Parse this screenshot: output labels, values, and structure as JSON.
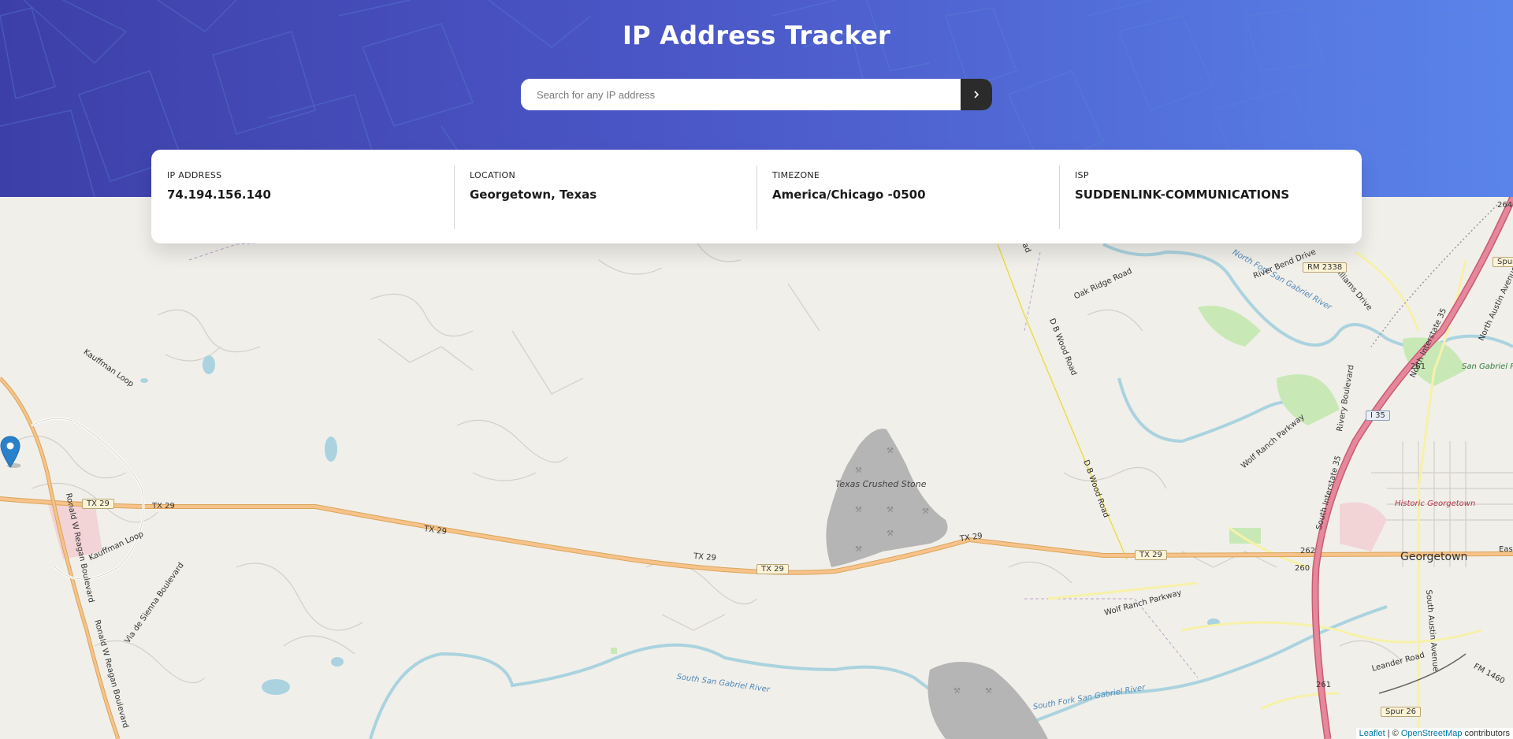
{
  "header": {
    "title": "IP Address Tracker",
    "search": {
      "placeholder": "Search for any IP address",
      "value": "",
      "submit_icon": "chevron-right-icon"
    }
  },
  "info": [
    {
      "label": "IP Address",
      "value": "74.194.156.140"
    },
    {
      "label": "Location",
      "value": "Georgetown, Texas"
    },
    {
      "label": "Timezone",
      "value": "America/Chicago -0500"
    },
    {
      "label": "ISP",
      "value": "SUDDENLINK-COMMUNICATIONS"
    }
  ],
  "map": {
    "marker_icon": "map-pin-icon",
    "labels": {
      "tx29": "TX 29",
      "texas_crushed_stone": "Texas Crushed Stone",
      "georgetown": "Georgetown",
      "historic_georgetown": "Historic Georgetown",
      "san_gabriel_park": "San Gabriel Park",
      "south_san_gabriel_river": "South San Gabriel River",
      "south_fork_san_gabriel_river": "South Fork San Gabriel River",
      "north_fork_san_gabriel_river": "North Fork San Gabriel River",
      "wolf_ranch_parkway": "Wolf Ranch Parkway",
      "db_wood_road": "D B Wood Road",
      "oak_ridge_road": "Oak Ridge Road",
      "kauffman_loop": "Kauffman Loop",
      "ronald_reagan": "Ronald W Reagan Boulevard",
      "via_de_sienna": "Via de Sienna Boulevard",
      "leander_road": "Leander Road",
      "river_bend_drive": "River Bend Drive",
      "williams_drive": "Williams Drive",
      "north_austin_avenue": "North Austin Avenue",
      "south_austin_avenue": "South Austin Avenue",
      "north_interstate_35": "North Interstate 35",
      "south_interstate_35": "South Interstate 35",
      "rivery_boulevard": "Rivery Boulevard",
      "rm2338": "RM 2338",
      "i35": "I 35",
      "spur26": "Spur 26",
      "fm1460": "FM 1460",
      "spur": "Spur",
      "east": "East",
      "n261": "261",
      "n262": "262",
      "n260": "260",
      "n264": "264"
    },
    "attribution": {
      "leaflet": "Leaflet",
      "sep": " | © ",
      "osm": "OpenStreetMap",
      "contributors": " contributors"
    },
    "colors": {
      "land": "#f1efea",
      "water": "#aad3df",
      "highway": "#f7c38a",
      "interstate": "#e6879b",
      "quarry": "#b5b5b5",
      "park": "#c8e9b6"
    }
  }
}
